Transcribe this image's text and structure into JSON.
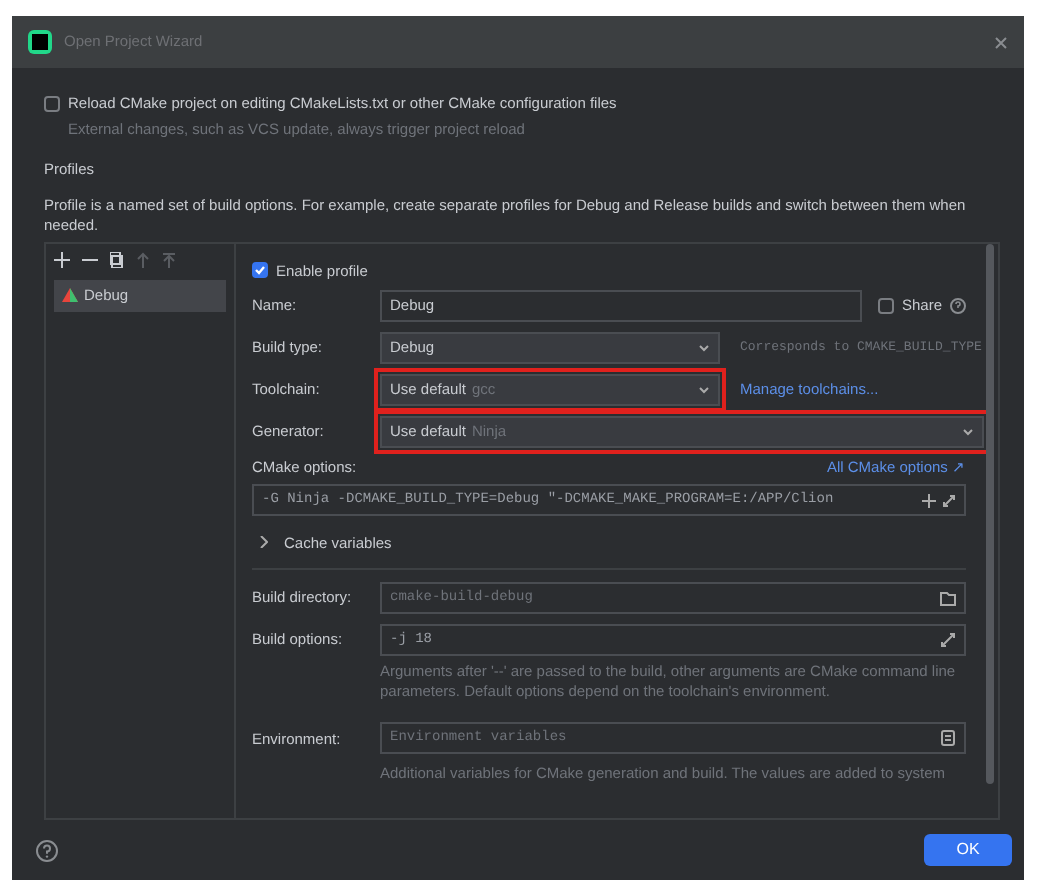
{
  "window": {
    "title": "Open Project Wizard"
  },
  "reload_option": {
    "label": "Reload CMake project on editing CMakeLists.txt or other CMake configuration files",
    "description": "External changes, such as VCS update, always trigger project reload",
    "checked": false
  },
  "profiles_heading": "Profiles",
  "profiles_description": "Profile is a named set of build options. For example, create separate profiles for Debug and Release builds and switch between them when needed.",
  "profiles": [
    {
      "name": "Debug",
      "selected": true
    }
  ],
  "enable_profile": {
    "label": "Enable profile",
    "checked": true
  },
  "name_field": {
    "label": "Name:",
    "value": "Debug",
    "share_label": "Share",
    "share_checked": false
  },
  "build_type": {
    "label": "Build type:",
    "value": "Debug",
    "hint": "Corresponds to CMAKE_BUILD_TYPE"
  },
  "toolchain": {
    "label": "Toolchain:",
    "value": "Use default",
    "detail": "gcc",
    "link": "Manage toolchains...",
    "highlighted": true
  },
  "generator": {
    "label": "Generator:",
    "value": "Use default",
    "detail": "Ninja",
    "highlighted": true
  },
  "cmake_options": {
    "label": "CMake options:",
    "link": "All CMake options ↗",
    "value": "-G Ninja -DCMAKE_BUILD_TYPE=Debug \"-DCMAKE_MAKE_PROGRAM=E:/APP/Clion"
  },
  "cache_variables": {
    "label": "Cache variables",
    "expanded": false
  },
  "build_directory": {
    "label": "Build directory:",
    "placeholder": "cmake-build-debug"
  },
  "build_options": {
    "label": "Build options:",
    "value": "-j 18",
    "hint": "Arguments after '--' are passed to the build, other arguments are CMake command line parameters. Default options depend on the toolchain's environment."
  },
  "environment": {
    "label": "Environment:",
    "placeholder": "Environment variables",
    "hint": "Additional variables for CMake generation and build. The values are added to system"
  },
  "buttons": [
    "OK"
  ]
}
